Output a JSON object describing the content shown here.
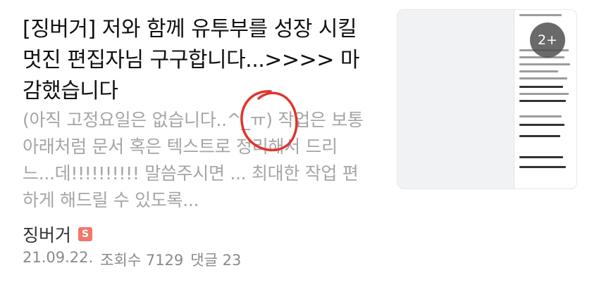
{
  "post": {
    "title": "[징버거] 저와 함께 유투부를 성장 시킬 멋진 편집자님 구구합니다...>>>> 마감했습니다",
    "snippet": "(아직 고정요일은 없습니다..^_ㅠ) 작업은 보통 아래처럼 문서 혹은 텍스트로 정리해서 드리느...데!!!!!!!!!! 말씀주시면 ... 최대한 작업 편하게 해드릴 수 있도록...",
    "author": "징버거",
    "author_badge": "S",
    "date": "21.09.22.",
    "views_label": "조회수 7129",
    "comments_label": "댓글 23"
  },
  "thumbnail": {
    "image_count": "2+"
  },
  "colors": {
    "title": "#111111",
    "snippet": "#a5a5a5",
    "meta": "#8a8a8a",
    "badge": "#f2776a",
    "circle_mark": "#e0342c"
  }
}
